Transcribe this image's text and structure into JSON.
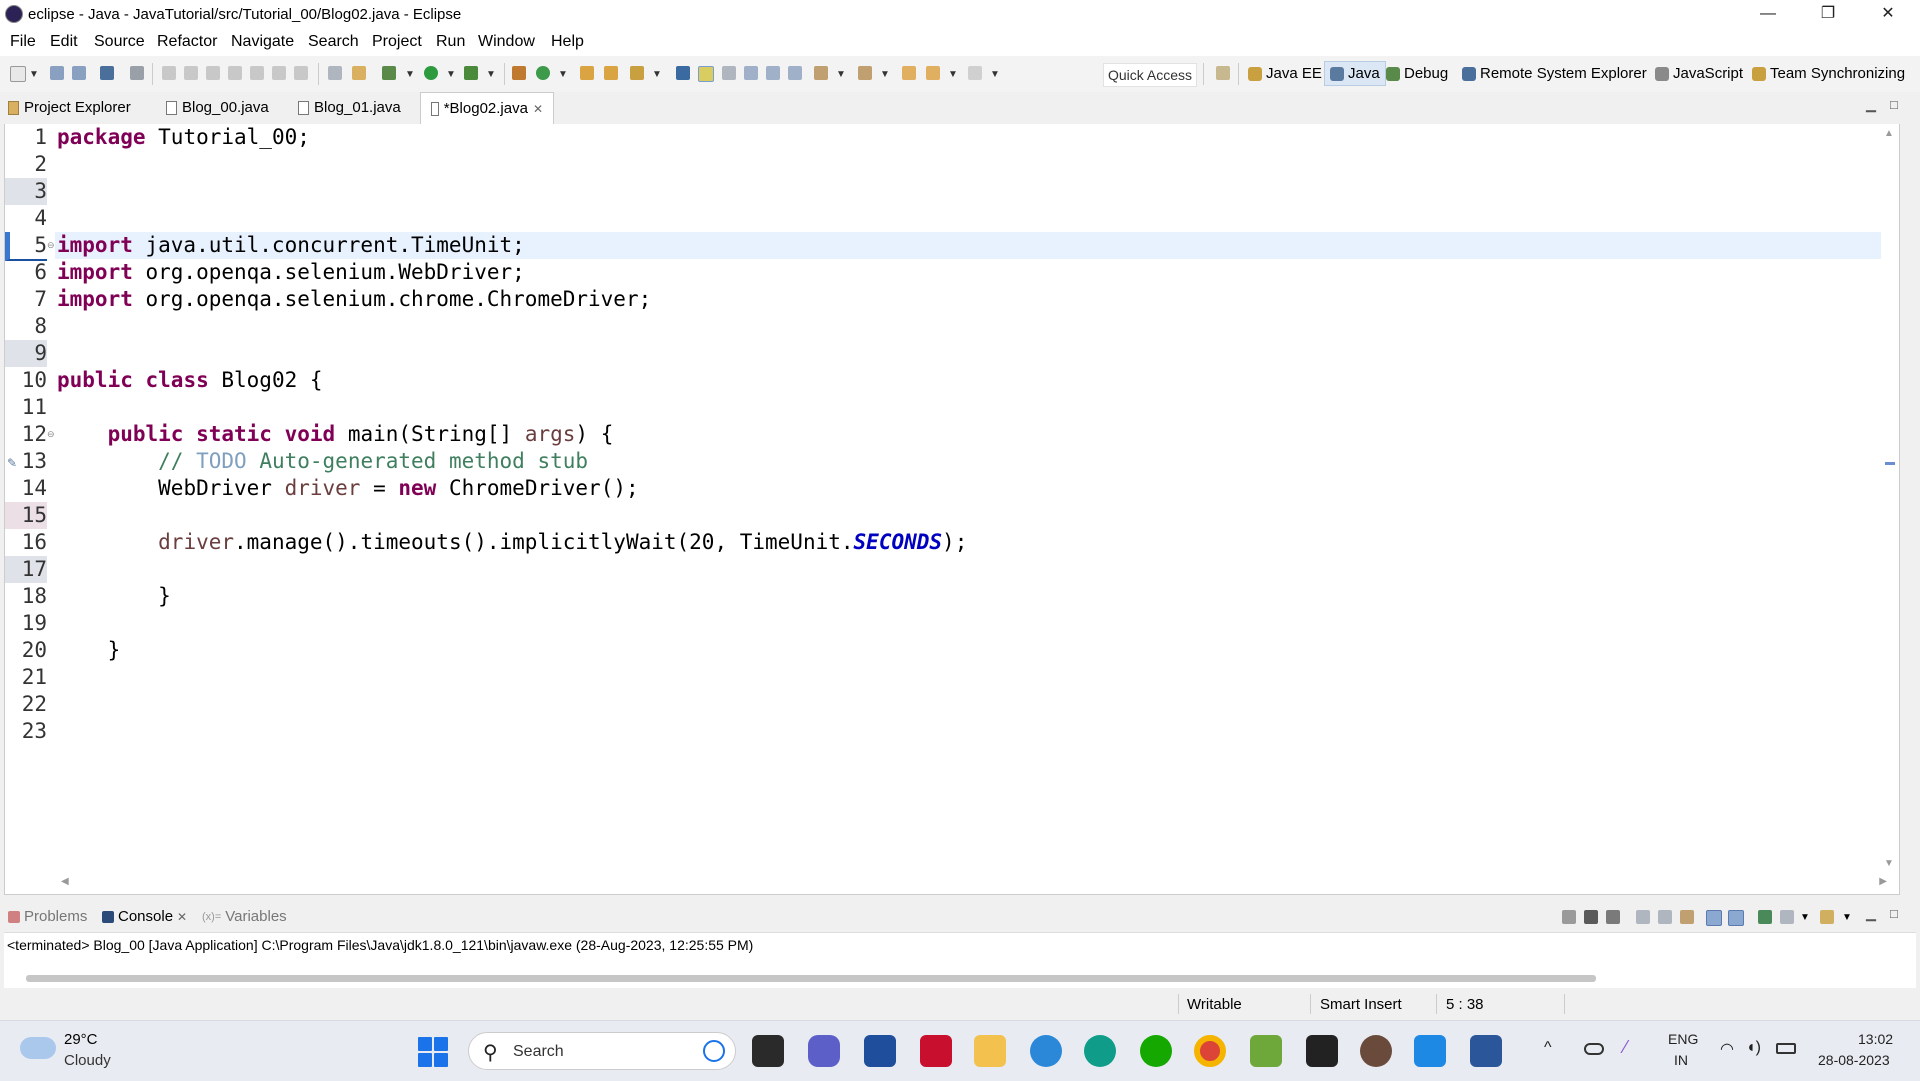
{
  "window": {
    "title": "eclipse - Java - JavaTutorial/src/Tutorial_00/Blog02.java - Eclipse",
    "controls": {
      "minimize": "—",
      "restore": "❐",
      "close": "✕"
    }
  },
  "menu": [
    "File",
    "Edit",
    "Source",
    "Refactor",
    "Navigate",
    "Search",
    "Project",
    "Run",
    "Window",
    "Help"
  ],
  "toolbar": {
    "quick_access": "Quick Access",
    "perspectives": [
      "Java EE",
      "Java",
      "Debug",
      "Remote System Explorer",
      "JavaScript",
      "Team Synchronizing"
    ],
    "active_perspective": "Java"
  },
  "editor_tabs": [
    {
      "label": "Project Explorer"
    },
    {
      "label": "Blog_00.java"
    },
    {
      "label": "Blog_01.java"
    },
    {
      "label": "*Blog02.java",
      "active": true
    }
  ],
  "code": {
    "line_numbers": [
      "1",
      "2",
      "3",
      "4",
      "5",
      "6",
      "7",
      "8",
      "9",
      "10",
      "11",
      "12",
      "13",
      "14",
      "15",
      "16",
      "17",
      "18",
      "19",
      "20",
      "21",
      "22",
      "23"
    ],
    "line1": [
      "package",
      " Tutorial_00;"
    ],
    "line5": [
      "import",
      " java.util.concurrent.TimeUnit;"
    ],
    "line6": [
      "import",
      " org.openqa.selenium.WebDriver;"
    ],
    "line7": [
      "import",
      " org.openqa.selenium.chrome.ChromeDriver;"
    ],
    "line10": [
      "public",
      "class",
      " Blog02 {"
    ],
    "line12": [
      "public",
      "static",
      "void",
      " main(String[] ",
      "args",
      ") {"
    ],
    "line13": [
      "// ",
      "TODO",
      " Auto-generated method stub"
    ],
    "line14": [
      "WebDriver ",
      "driver",
      " = ",
      "new",
      " ChromeDriver();"
    ],
    "line16": [
      "driver",
      ".manage().timeouts().implicitlyWait(20, TimeUnit.",
      "SECONDS",
      ");"
    ],
    "line18": "}",
    "line20": "}"
  },
  "console": {
    "tabs": [
      "Problems",
      "Console",
      "Variables"
    ],
    "active_tab": "Console",
    "status": "<terminated> Blog_00 [Java Application] C:\\Program Files\\Java\\jdk1.8.0_121\\bin\\javaw.exe (28-Aug-2023, 12:25:55 PM)"
  },
  "statusbar": {
    "writable": "Writable",
    "insert_mode": "Smart Insert",
    "position": "5 : 38"
  },
  "taskbar": {
    "weather": {
      "temp": "29°C",
      "desc": "Cloudy"
    },
    "search_placeholder": "Search",
    "language": "ENG",
    "region": "IN",
    "time": "13:02",
    "date": "28-08-2023"
  }
}
